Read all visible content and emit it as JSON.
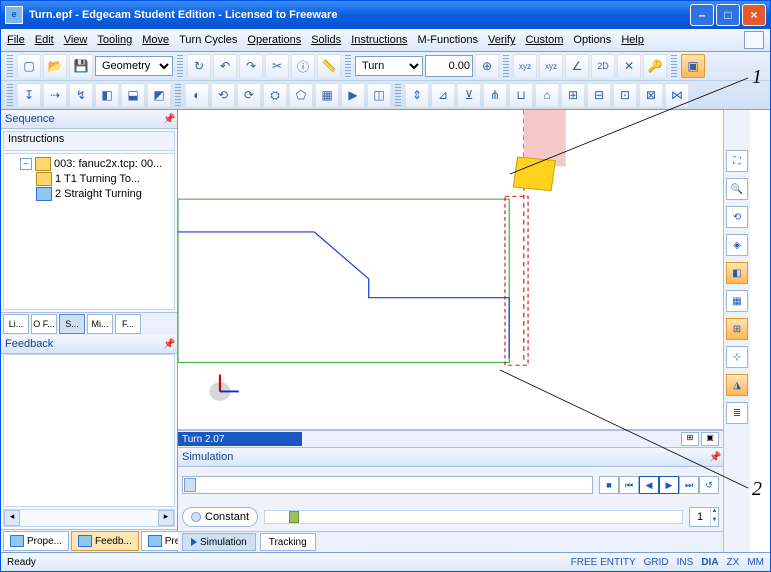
{
  "title": "Turn.epf - Edgecam Student Edition - Licensed to Freeware",
  "menus": [
    "File",
    "Edit",
    "View",
    "Tooling",
    "Move",
    "Turn Cycles",
    "Operations",
    "Solids",
    "Instructions",
    "M-Functions",
    "Verify",
    "Custom",
    "Options",
    "Help"
  ],
  "toolbar1": {
    "layer_select": "Geometry",
    "mode_select": "Turn",
    "coord": "0.00"
  },
  "sequence": {
    "title": "Sequence",
    "group": "Instructions",
    "root": "003: fanuc2x.tcp: 00...",
    "items": [
      "1 T1 Turning To...",
      "2 Straight Turning"
    ],
    "switcher": [
      "Li...",
      "O F...",
      "S...",
      "Mi...",
      "F..."
    ],
    "switcher_sel": 2
  },
  "feedback": {
    "title": "Feedback"
  },
  "bottom_tabs": [
    {
      "label": "Prope..."
    },
    {
      "label": "Feedb...",
      "sel": true
    },
    {
      "label": "Preview"
    }
  ],
  "time_label": "Turn 2.07",
  "simulation": {
    "title": "Simulation",
    "constant": "Constant",
    "spin": "1",
    "foot": [
      {
        "label": "Simulation",
        "sel": true
      },
      {
        "label": "Tracking"
      }
    ]
  },
  "status": {
    "left": "Ready",
    "right": [
      "FREE ENTITY",
      "GRID",
      "INS",
      "DIA",
      "ZX",
      "MM"
    ]
  },
  "annotations": [
    "1",
    "2"
  ]
}
